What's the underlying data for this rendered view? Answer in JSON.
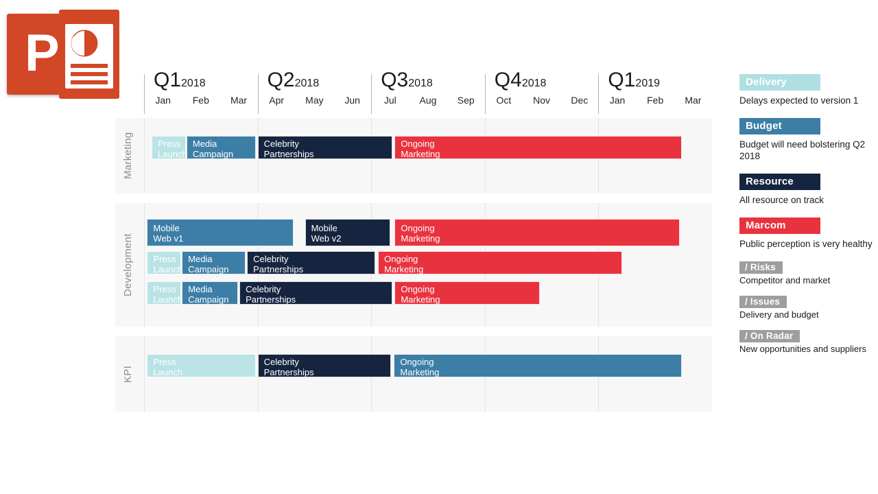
{
  "app": {
    "logo_name": "microsoft-powerpoint-logo",
    "logo_letter": "P"
  },
  "chart_data": {
    "type": "gantt",
    "title": "",
    "quarters": [
      {
        "label": "Q1",
        "year": "2018",
        "months": [
          "Jan",
          "Feb",
          "Mar"
        ]
      },
      {
        "label": "Q2",
        "year": "2018",
        "months": [
          "Apr",
          "May",
          "Jun"
        ]
      },
      {
        "label": "Q3",
        "year": "2018",
        "months": [
          "Jul",
          "Aug",
          "Sep"
        ]
      },
      {
        "label": "Q4",
        "year": "2018",
        "months": [
          "Oct",
          "Nov",
          "Dec"
        ]
      },
      {
        "label": "Q1",
        "year": "2019",
        "months": [
          "Jan",
          "Feb",
          "Mar"
        ]
      }
    ],
    "axis_range_months": 15,
    "colors": {
      "cyan": "#b9e3e5",
      "steel": "#3d7ea6",
      "navy": "#16253f",
      "red": "#e8333f",
      "band": "#f7f7f7",
      "gray": "#9e9e9e"
    },
    "swimlanes": [
      {
        "label": "Marketing",
        "rows": [
          {
            "bars": [
              {
                "line1": "Press",
                "line2": "Launch",
                "color": "cyan",
                "start_month": 0.2,
                "end_month": 1.1
              },
              {
                "line1": "Media",
                "line2": "Campaign",
                "color": "steel",
                "start_month": 1.12,
                "end_month": 2.95
              },
              {
                "line1": "Celebrity",
                "line2": "Partnerships",
                "color": "navy",
                "start_month": 3.0,
                "end_month": 6.55
              },
              {
                "line1": "Ongoing",
                "line2": "Marketing",
                "color": "red",
                "start_month": 6.62,
                "end_month": 14.2
              }
            ]
          }
        ]
      },
      {
        "label": "Development",
        "rows": [
          {
            "bars": [
              {
                "line1": "Mobile",
                "line2": "Web v1",
                "color": "steel",
                "start_month": 0.08,
                "end_month": 3.95
              },
              {
                "line1": "Mobile",
                "line2": "Web v2",
                "color": "navy",
                "start_month": 4.25,
                "end_month": 6.5
              },
              {
                "line1": "Ongoing",
                "line2": "Marketing",
                "color": "red",
                "start_month": 6.62,
                "end_month": 14.15
              }
            ]
          },
          {
            "bars": [
              {
                "line1": "Press",
                "line2": "Launch",
                "color": "cyan",
                "start_month": 0.08,
                "end_month": 0.98
              },
              {
                "line1": "Media",
                "line2": "Campaign",
                "color": "steel",
                "start_month": 1.0,
                "end_month": 2.68
              },
              {
                "line1": "Celebrity",
                "line2": "Partnerships",
                "color": "navy",
                "start_month": 2.72,
                "end_month": 6.1
              },
              {
                "line1": "Ongoing",
                "line2": "Marketing",
                "color": "red",
                "start_month": 6.18,
                "end_month": 12.62
              }
            ]
          },
          {
            "bars": [
              {
                "line1": "Press",
                "line2": "Launch",
                "color": "cyan",
                "start_month": 0.08,
                "end_month": 0.98
              },
              {
                "line1": "Media",
                "line2": "Campaign",
                "color": "steel",
                "start_month": 1.0,
                "end_month": 2.48
              },
              {
                "line1": "Celebrity",
                "line2": "Partnerships",
                "color": "navy",
                "start_month": 2.52,
                "end_month": 6.55
              },
              {
                "line1": "Ongoing",
                "line2": "Marketing",
                "color": "red",
                "start_month": 6.62,
                "end_month": 10.45
              }
            ]
          }
        ]
      },
      {
        "label": "KPI",
        "rows": [
          {
            "bars": [
              {
                "line1": "Press",
                "line2": "Launch",
                "color": "cyan",
                "start_month": 0.08,
                "end_month": 2.95
              },
              {
                "line1": "Celebrity",
                "line2": "Partnerships",
                "color": "navy",
                "start_month": 3.0,
                "end_month": 6.52
              },
              {
                "line1": "Ongoing",
                "line2": "Marketing",
                "color": "steel",
                "start_month": 6.6,
                "end_month": 14.2
              }
            ]
          }
        ]
      }
    ]
  },
  "side_panel": {
    "status_items": [
      {
        "title": "Delivery",
        "color": "cyan",
        "text": "Delays expected to version 1"
      },
      {
        "title": "Budget",
        "color": "steel",
        "text": "Budget will need bolstering Q2 2018"
      },
      {
        "title": "Resource",
        "color": "navy",
        "text": "All resource on track"
      },
      {
        "title": "Marcom",
        "color": "red",
        "text": "Public perception is very healthy"
      }
    ],
    "note_items": [
      {
        "title": "/ Risks",
        "text": "Competitor and market"
      },
      {
        "title": "/ Issues",
        "text": "Delivery and budget"
      },
      {
        "title": "/ On Radar",
        "text": "New opportunities and suppliers"
      }
    ]
  }
}
